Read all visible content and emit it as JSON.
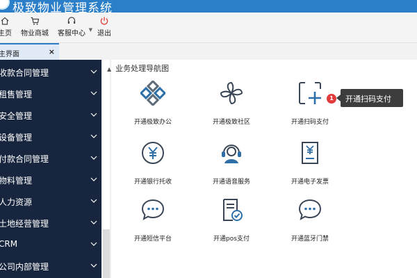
{
  "app": {
    "title": "极致物业管理系统"
  },
  "toolbar": {
    "items": [
      {
        "label": "主页",
        "icon": "home-icon"
      },
      {
        "label": "物业商城",
        "icon": "cart-icon"
      },
      {
        "label": "客服中心",
        "icon": "headset-icon"
      },
      {
        "label": "退出",
        "icon": "power-icon"
      }
    ]
  },
  "tabs": [
    {
      "label": "主界面",
      "close": "×"
    }
  ],
  "sidebar": {
    "items": [
      {
        "label": "收款合同管理"
      },
      {
        "label": "租售管理"
      },
      {
        "label": "安全管理"
      },
      {
        "label": "设备管理"
      },
      {
        "label": "付款合同管理"
      },
      {
        "label": "物料管理"
      },
      {
        "label": "人力资源"
      },
      {
        "label": "土地经营管理"
      },
      {
        "label": "CRM"
      },
      {
        "label": "公司内部管理"
      }
    ]
  },
  "main": {
    "section_title": "业务处理导航图",
    "tiles": [
      {
        "label": "开通极致办公",
        "icon": "office-logo-icon"
      },
      {
        "label": "开通极致社区",
        "icon": "pinwheel-icon"
      },
      {
        "label": "开通扫码支付",
        "icon": "scan-add-icon"
      },
      {
        "label": "开通银行托收",
        "icon": "yen-circle-icon"
      },
      {
        "label": "开通语音服务",
        "icon": "agent-headset-icon"
      },
      {
        "label": "开通电子发票",
        "icon": "invoice-icon"
      },
      {
        "label": "开通短信平台",
        "icon": "chat-bubble-icon"
      },
      {
        "label": "开通pos支付",
        "icon": "pos-receipt-icon"
      },
      {
        "label": "开通蓝牙门禁",
        "icon": "chat-bubble-icon"
      }
    ],
    "badge": "1",
    "tooltip": "开通扫码支付"
  },
  "colors": {
    "titlebar": "#2b7fc9",
    "sidebar": "#17253e",
    "accent": "#2f6fa8",
    "badge": "#e23b3b",
    "power": "#e23b3b"
  }
}
